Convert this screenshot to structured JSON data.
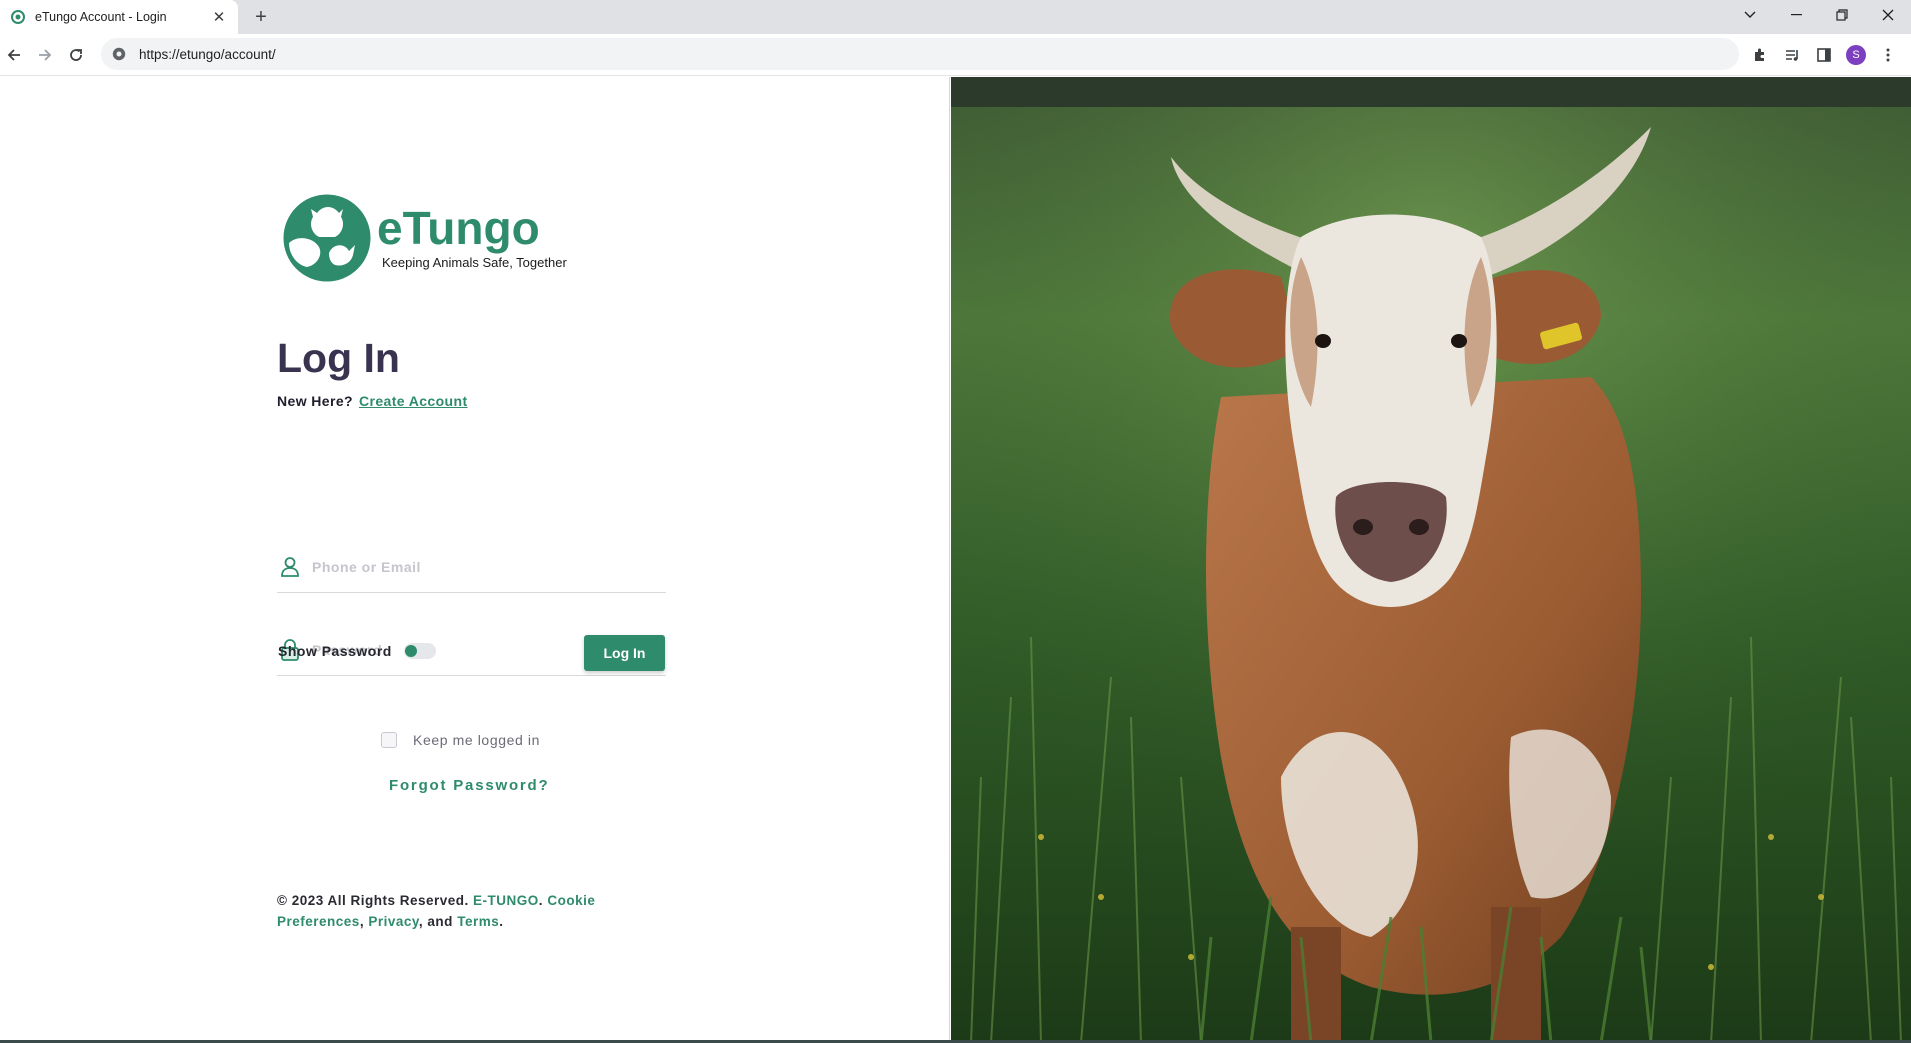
{
  "browser": {
    "tab_title": "eTungo Account - Login",
    "tab_close": "✕",
    "new_tab": "+",
    "url": "https://etungo/account/",
    "profile_initial": "S"
  },
  "brand": {
    "name": "eTungo",
    "tagline": "Keeping Animals Safe, Together",
    "accent_color": "#2e8b6b"
  },
  "login": {
    "title": "Log In",
    "new_here": "New Here?",
    "create_account": "Create Account",
    "phone_placeholder": "Phone or Email",
    "password_placeholder": "Password",
    "show_password": "Show Password",
    "show_password_on": false,
    "login_button": "Log In",
    "keep_logged_in": "Keep me logged in",
    "forgot_password": "Forgot Password?"
  },
  "footer": {
    "copyright": "© 2023 All Rights Reserved.",
    "company": "E-TUNGO",
    "cookie": "Cookie Preferences",
    "privacy": "Privacy",
    "and": "and",
    "terms": "Terms"
  },
  "hero": {
    "icon": "cow-photo"
  }
}
